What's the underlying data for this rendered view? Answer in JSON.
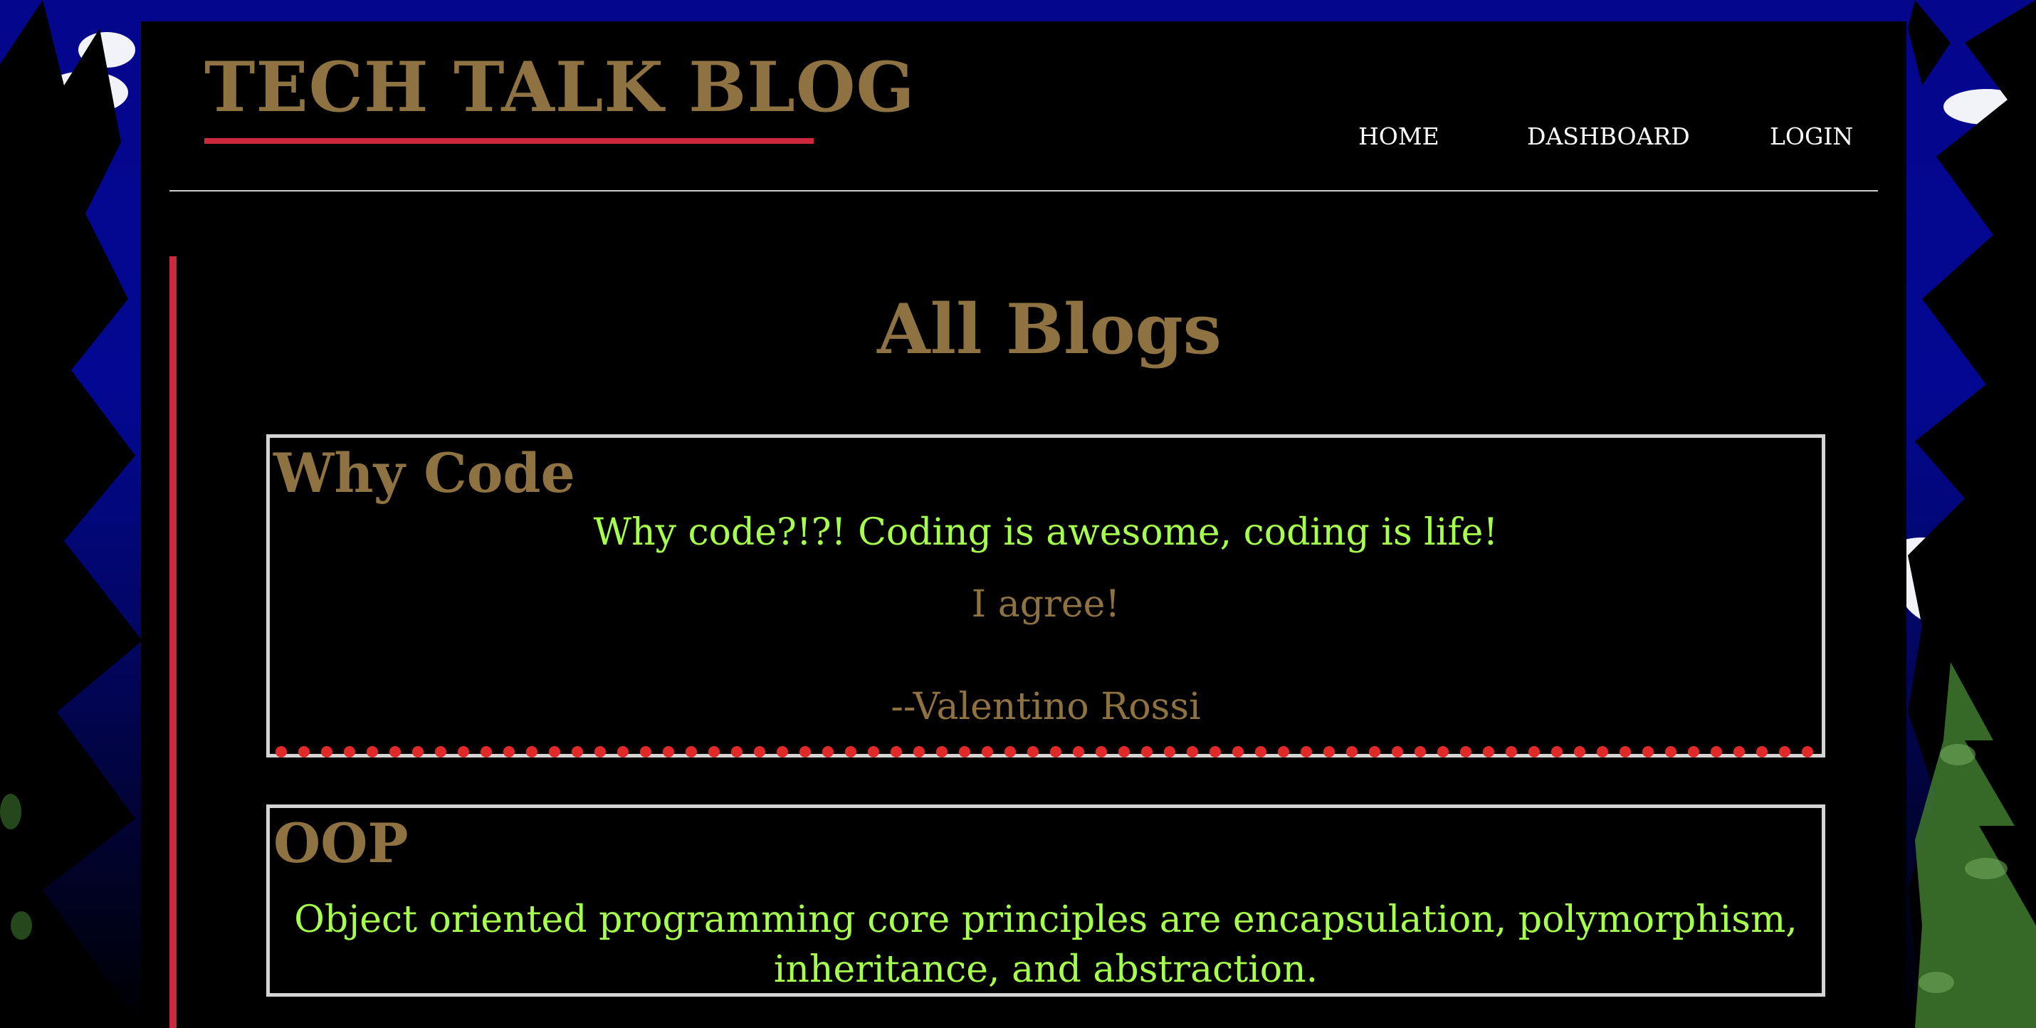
{
  "header": {
    "brand": "TECH TALK BLOG",
    "nav": {
      "home": "HOME",
      "dashboard": "DASHBOARD",
      "login": "LOGIN"
    }
  },
  "main": {
    "title": "All Blogs",
    "posts": [
      {
        "title": "Why Code",
        "body": "Why code?!?! Coding is awesome, coding is life!",
        "comment": {
          "text": "I agree!",
          "author": "--Valentino Rossi"
        }
      },
      {
        "title": "OOP",
        "body": "Object oriented programming core principles are encapsulation, polymorphism, inheritance, and abstraction."
      }
    ]
  },
  "colors": {
    "brand_gold": "#8f7242",
    "accent_red": "#cc2a3c",
    "body_green": "#a6ff4d",
    "panel_black": "#000000",
    "sky_blue": "#04068c"
  },
  "icons": {
    "background": "night-sky-pine-trees-image"
  }
}
